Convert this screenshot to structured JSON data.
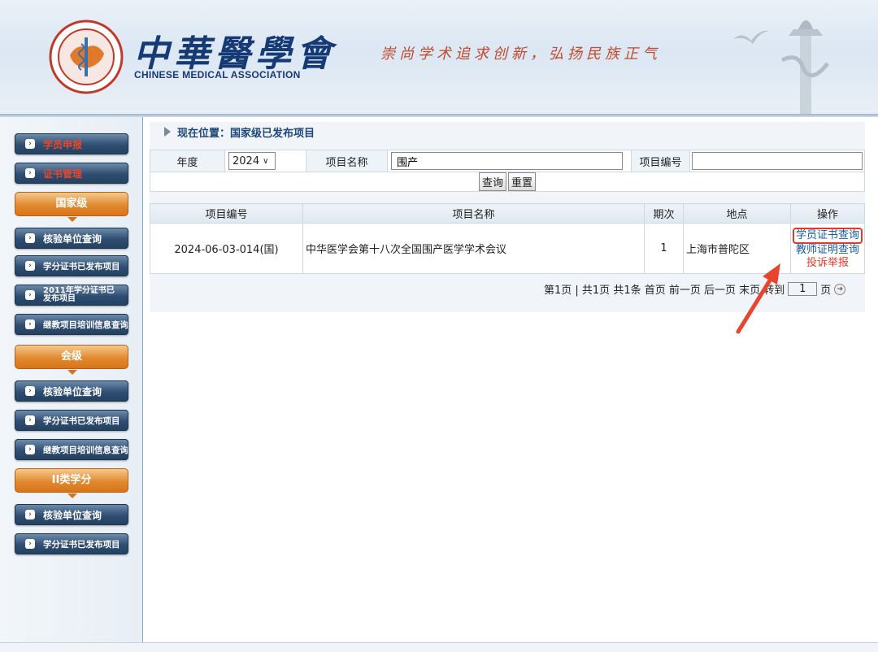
{
  "header": {
    "org_name_cn": "中華醫學會",
    "org_name_en": "CHINESE MEDICAL ASSOCIATION",
    "slogan": "崇尚学术追求创新，弘扬民族正气"
  },
  "sidebar": {
    "top_items": [
      {
        "label": "学员申报"
      },
      {
        "label": "证书管理"
      }
    ],
    "sections": [
      {
        "title": "国家级",
        "items": [
          "核验单位查询",
          "学分证书已发布项目",
          "2011年学分证书已发布项目",
          "继教项目培训信息查询"
        ]
      },
      {
        "title": "会级",
        "items": [
          "核验单位查询",
          "学分证书已发布项目",
          "继教项目培训信息查询"
        ]
      },
      {
        "title": "II类学分",
        "items": [
          "核验单位查询",
          "学分证书已发布项目"
        ]
      }
    ]
  },
  "breadcrumb": {
    "text": "现在位置：国家级已发布项目"
  },
  "search": {
    "year_label": "年度",
    "year_value": "2024",
    "name_label": "项目名称",
    "name_value": "围产",
    "code_label": "项目编号",
    "code_value": "",
    "query_button": "查询",
    "reset_button": "重置"
  },
  "results": {
    "columns": [
      "项目编号",
      "项目名称",
      "期次",
      "地点",
      "操作"
    ],
    "rows": [
      {
        "code": "2024-06-03-014(国)",
        "name": "中华医学会第十八次全国围产医学学术会议",
        "session": "1",
        "location": "上海市普陀区",
        "actions": [
          "学员证书查询",
          "教师证明查询",
          "投诉举报"
        ]
      }
    ]
  },
  "pager": {
    "info": "第1页 | 共1页 共1条  首页 前一页 后一页 末页 转到",
    "page_value": "1",
    "page_unit": "页"
  },
  "colors": {
    "accent_blue": "#1e467a",
    "highlight_red": "#e03a2c",
    "section_orange": "#e08a2f"
  }
}
